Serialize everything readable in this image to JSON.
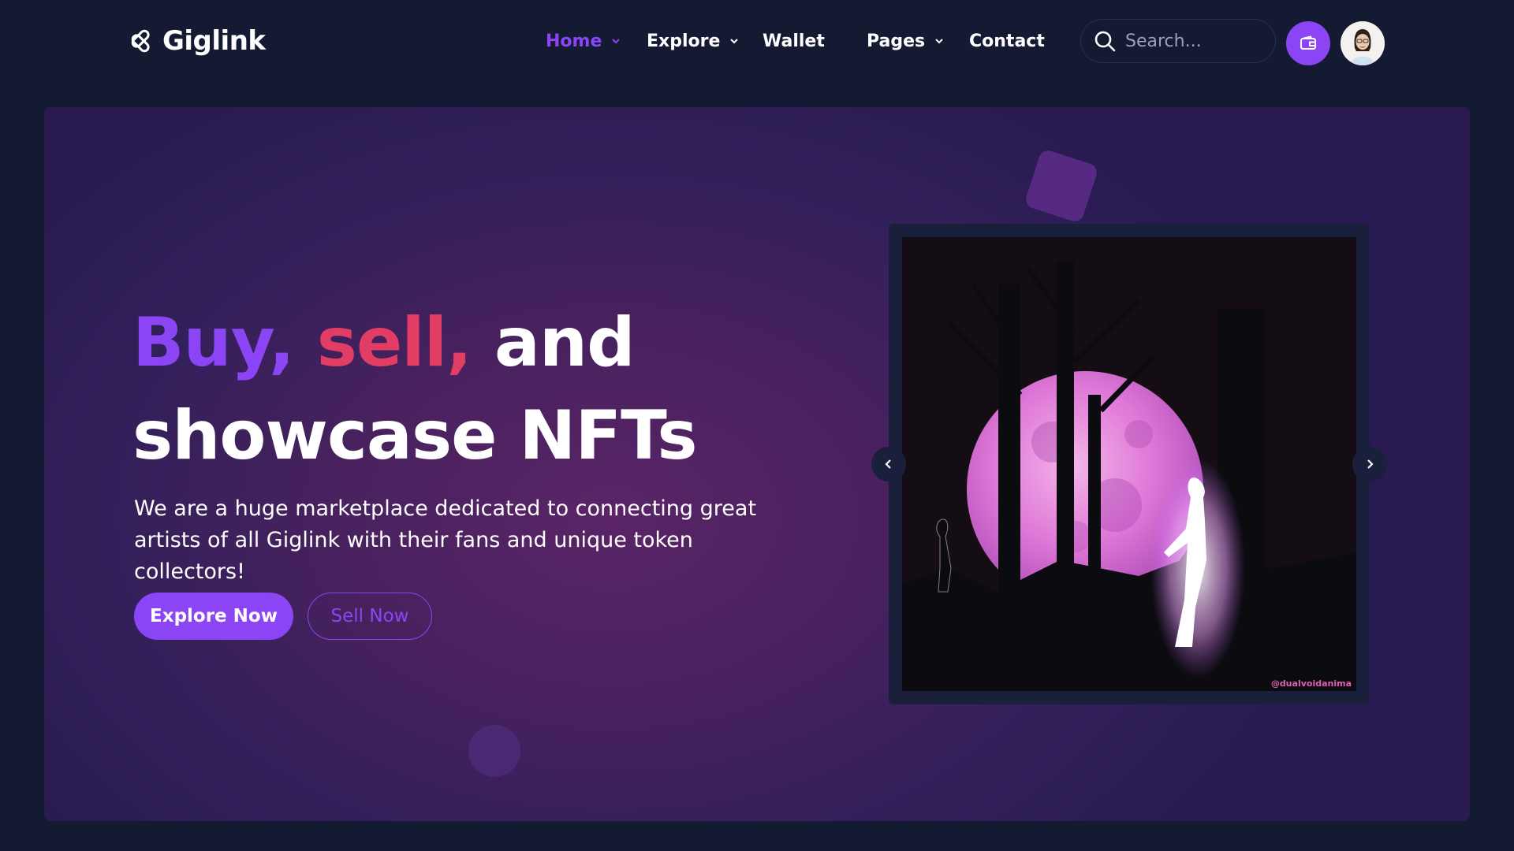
{
  "brand": {
    "name": "Giglink",
    "logo_icon": "giglink-logo-icon"
  },
  "nav": {
    "items": [
      {
        "label": "Home",
        "active": true,
        "has_dropdown": true
      },
      {
        "label": "Explore",
        "active": false,
        "has_dropdown": true
      },
      {
        "label": "Wallet",
        "active": false,
        "has_dropdown": false
      },
      {
        "label": "Pages",
        "active": false,
        "has_dropdown": true
      },
      {
        "label": "Contact",
        "active": false,
        "has_dropdown": false
      }
    ],
    "search_placeholder": "Search...",
    "wallet_icon": "wallet-icon",
    "avatar_icon": "user-avatar"
  },
  "hero": {
    "headline": {
      "word1": "Buy,",
      "word2": "sell,",
      "word3": "and",
      "line2": "showcase NFTs"
    },
    "description": "We are a huge marketplace dedicated to connecting great artists of all Giglink with their fans and unique token collectors!",
    "primary_button": "Explore Now",
    "secondary_button": "Sell Now",
    "slider": {
      "image_credit": "@dualvoidanima",
      "prev_icon": "chevron-left-icon",
      "next_icon": "chevron-right-icon"
    }
  },
  "colors": {
    "page_background": "#141a32",
    "accent_purple": "#8b45f5",
    "accent_pink": "#e13d65",
    "hero_background": "#47215e",
    "text_white": "#ffffff"
  }
}
